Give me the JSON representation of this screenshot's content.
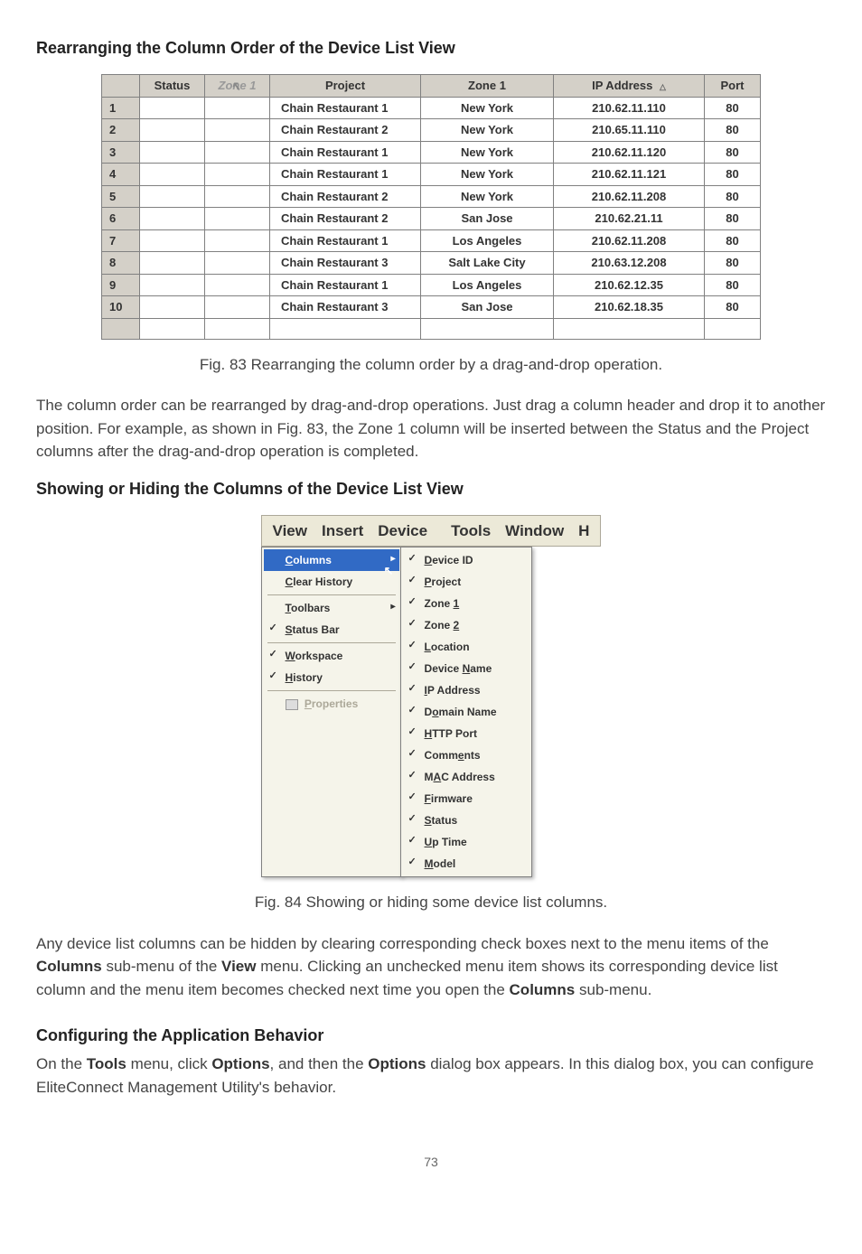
{
  "heading1": "Rearranging the Column Order of the Device List View",
  "table_headers": {
    "row_num": "",
    "status": "Status",
    "zone_drag": "Zone 1",
    "project": "Project",
    "zone1": "Zone 1",
    "ip": "IP Address",
    "port": "Port"
  },
  "rows": [
    {
      "n": "1",
      "project": "Chain Restaurant 1",
      "zone1": "New York",
      "ip": "210.62.11.110",
      "port": "80"
    },
    {
      "n": "2",
      "project": "Chain Restaurant 2",
      "zone1": "New York",
      "ip": "210.65.11.110",
      "port": "80"
    },
    {
      "n": "3",
      "project": "Chain Restaurant 1",
      "zone1": "New York",
      "ip": "210.62.11.120",
      "port": "80"
    },
    {
      "n": "4",
      "project": "Chain Restaurant 1",
      "zone1": "New York",
      "ip": "210.62.11.121",
      "port": "80"
    },
    {
      "n": "5",
      "project": "Chain Restaurant 2",
      "zone1": "New York",
      "ip": "210.62.11.208",
      "port": "80"
    },
    {
      "n": "6",
      "project": "Chain Restaurant 2",
      "zone1": "San Jose",
      "ip": "210.62.21.11",
      "port": "80"
    },
    {
      "n": "7",
      "project": "Chain Restaurant 1",
      "zone1": "Los Angeles",
      "ip": "210.62.11.208",
      "port": "80"
    },
    {
      "n": "8",
      "project": "Chain Restaurant 3",
      "zone1": "Salt Lake City",
      "ip": "210.63.12.208",
      "port": "80"
    },
    {
      "n": "9",
      "project": "Chain Restaurant 1",
      "zone1": "Los Angeles",
      "ip": "210.62.12.35",
      "port": "80"
    },
    {
      "n": "10",
      "project": "Chain Restaurant 3",
      "zone1": "San Jose",
      "ip": "210.62.18.35",
      "port": "80"
    }
  ],
  "fig83": "Fig. 83 Rearranging the column order by a drag-and-drop operation.",
  "para1": "The column order can be rearranged by drag-and-drop operations. Just drag a column header and drop it to another position. For example, as shown in Fig. 83, the Zone 1 column will be inserted between the Status and the Project columns after the drag-and-drop operation is completed.",
  "heading2": "Showing or Hiding the Columns of the Device List View",
  "menubar": [
    "View",
    "Insert",
    "Device",
    "Tools",
    "Window",
    "H"
  ],
  "view_menu": {
    "columns": "Columns",
    "clear_history": "Clear History",
    "toolbars": "Toolbars",
    "status_bar": "Status Bar",
    "workspace": "Workspace",
    "history": "History",
    "properties": "Properties"
  },
  "columns_submenu": [
    {
      "label": "Device ID",
      "u": "D"
    },
    {
      "label": "Project",
      "u": "P"
    },
    {
      "label": "Zone 1",
      "u": "1"
    },
    {
      "label": "Zone 2",
      "u": "2"
    },
    {
      "label": "Location",
      "u": "L"
    },
    {
      "label": "Device Name",
      "u": "N"
    },
    {
      "label": "IP Address",
      "u": "I"
    },
    {
      "label": "Domain Name",
      "u": "o"
    },
    {
      "label": "HTTP Port",
      "u": "H"
    },
    {
      "label": "Comments",
      "u": "e"
    },
    {
      "label": "MAC Address",
      "u": "A"
    },
    {
      "label": "Firmware",
      "u": "F"
    },
    {
      "label": "Status",
      "u": "S"
    },
    {
      "label": "Up Time",
      "u": "U"
    },
    {
      "label": "Model",
      "u": "M"
    }
  ],
  "fig84": "Fig. 84 Showing or hiding some device list columns.",
  "para2_a": "Any device list columns can be hidden by clearing corresponding check boxes next to the menu items of the ",
  "para2_b": "Columns",
  "para2_c": " sub-menu of the ",
  "para2_d": "View",
  "para2_e": " menu. Clicking an unchecked menu item shows its corresponding device list column and the menu item becomes checked next time you open the ",
  "para2_f": "Columns",
  "para2_g": " sub-menu.",
  "heading3": "Configuring the Application Behavior",
  "para3_a": "On the ",
  "para3_b": "Tools",
  "para3_c": " menu, click ",
  "para3_d": "Options",
  "para3_e": ", and then the ",
  "para3_f": "Options",
  "para3_g": " dialog box appears. In this dialog box, you can configure EliteConnect Management Utility's behavior.",
  "page_num": "73"
}
